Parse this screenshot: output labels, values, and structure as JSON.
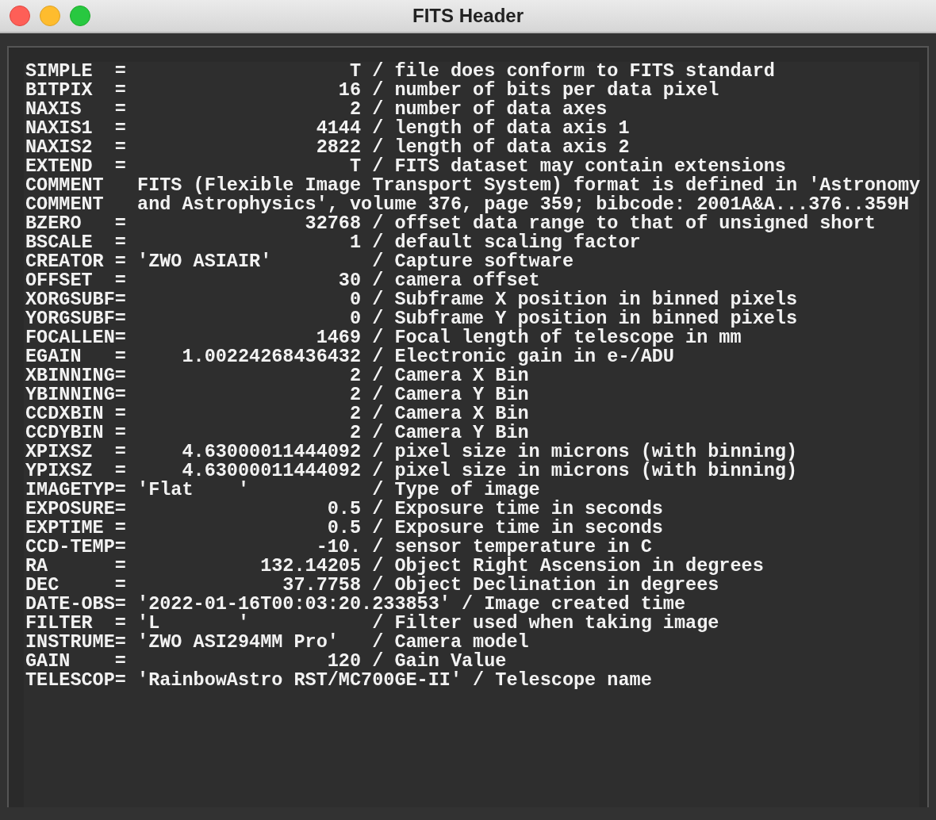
{
  "window": {
    "title": "FITS Header"
  },
  "header_lines": [
    "SIMPLE  =                    T / file does conform to FITS standard",
    "BITPIX  =                   16 / number of bits per data pixel",
    "NAXIS   =                    2 / number of data axes",
    "NAXIS1  =                 4144 / length of data axis 1",
    "NAXIS2  =                 2822 / length of data axis 2",
    "EXTEND  =                    T / FITS dataset may contain extensions",
    "COMMENT   FITS (Flexible Image Transport System) format is defined in 'Astronomy",
    "COMMENT   and Astrophysics', volume 376, page 359; bibcode: 2001A&A...376..359H",
    "BZERO   =                32768 / offset data range to that of unsigned short",
    "BSCALE  =                    1 / default scaling factor",
    "CREATOR = 'ZWO ASIAIR'         / Capture software",
    "OFFSET  =                   30 / camera offset",
    "XORGSUBF=                    0 / Subframe X position in binned pixels",
    "YORGSUBF=                    0 / Subframe Y position in binned pixels",
    "FOCALLEN=                 1469 / Focal length of telescope in mm",
    "EGAIN   =     1.00224268436432 / Electronic gain in e-/ADU",
    "XBINNING=                    2 / Camera X Bin",
    "YBINNING=                    2 / Camera Y Bin",
    "CCDXBIN =                    2 / Camera X Bin",
    "CCDYBIN =                    2 / Camera Y Bin",
    "XPIXSZ  =     4.63000011444092 / pixel size in microns (with binning)",
    "YPIXSZ  =     4.63000011444092 / pixel size in microns (with binning)",
    "IMAGETYP= 'Flat    '           / Type of image",
    "EXPOSURE=                  0.5 / Exposure time in seconds",
    "EXPTIME =                  0.5 / Exposure time in seconds",
    "CCD-TEMP=                 -10. / sensor temperature in C",
    "RA      =            132.14205 / Object Right Ascension in degrees",
    "DEC     =              37.7758 / Object Declination in degrees",
    "DATE-OBS= '2022-01-16T00:03:20.233853' / Image created time",
    "FILTER  = 'L       '           / Filter used when taking image",
    "INSTRUME= 'ZWO ASI294MM Pro'   / Camera model",
    "GAIN    =                  120 / Gain Value",
    "TELESCOP= 'RainbowAstro RST/MC700GE-II' / Telescope name"
  ]
}
